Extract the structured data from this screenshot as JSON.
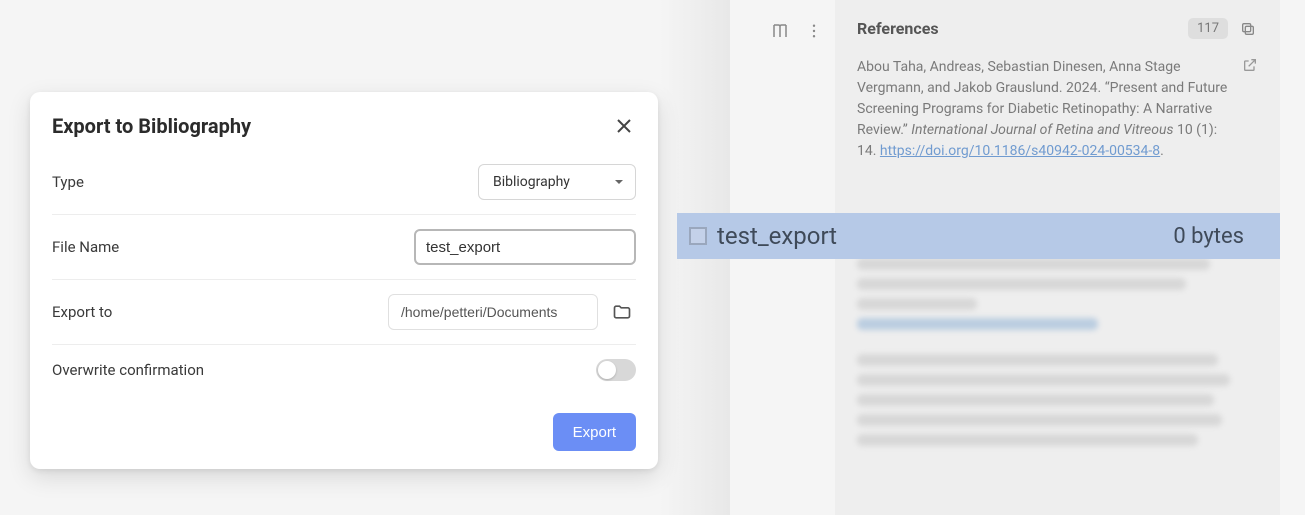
{
  "dialog": {
    "title": "Export to Bibliography",
    "type_label": "Type",
    "type_value": "Bibliography",
    "filename_label": "File Name",
    "filename_value": "test_export",
    "exportto_label": "Export to",
    "exportto_value": "/home/petteri/Documents",
    "overwrite_label": "Overwrite confirmation",
    "overwrite_value": false,
    "export_button": "Export"
  },
  "references_panel": {
    "title": "References",
    "count": "117",
    "item": {
      "authors": "Abou Taha, Andreas, Sebastian Dinesen, Anna Stage Vergmann, and Jakob Grauslund. 2024. ",
      "title_quoted": "“Present and Future Screening Programs for Diabetic Retinopathy: A Narrative Review.” ",
      "journal": "International Journal of Retina and Vitreous",
      "vol": " 10 (1): 14. ",
      "doi": "https://doi.org/10.1186/s40942-024-00534-8",
      "period": "."
    }
  },
  "file_bar": {
    "name": "test_export",
    "size": "0 bytes"
  }
}
